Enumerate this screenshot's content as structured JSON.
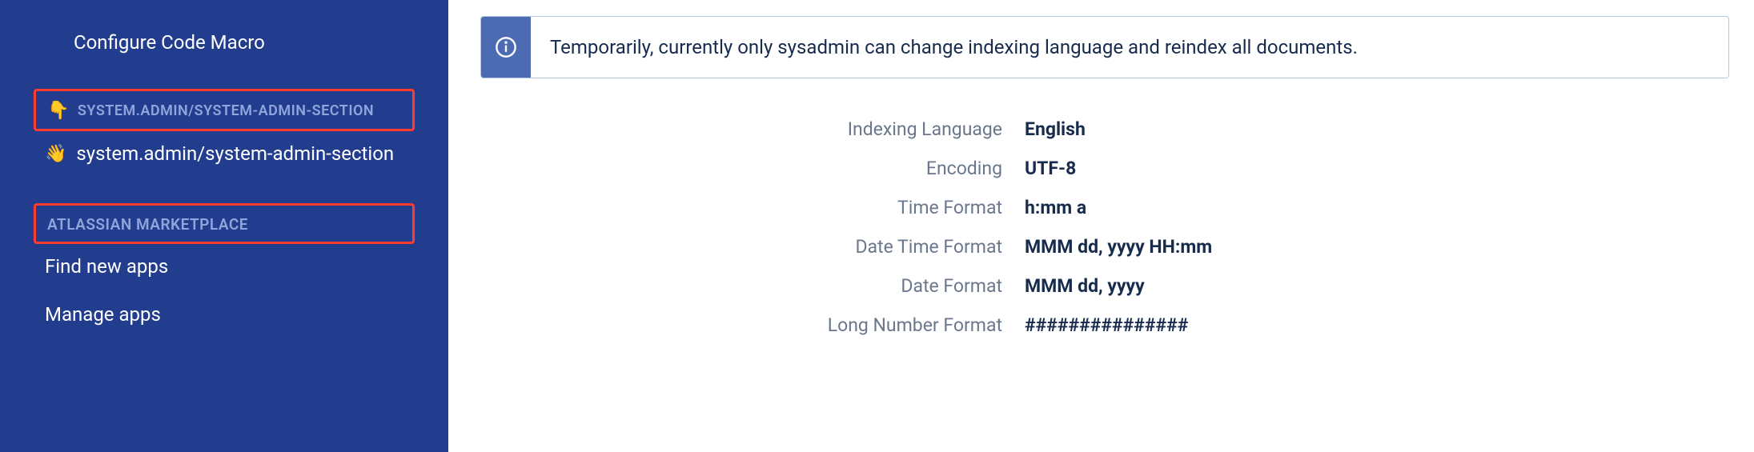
{
  "sidebar": {
    "configure_code_macro": "Configure Code Macro",
    "section1": {
      "header": "SYSTEM.ADMIN/SYSTEM-ADMIN-SECTION",
      "header_icon": "👇",
      "item_icon": "👋",
      "item_label": "system.admin/system-admin-section"
    },
    "section2": {
      "header": "ATLASSIAN MARKETPLACE",
      "items": [
        "Find new apps",
        "Manage apps"
      ]
    }
  },
  "banner": {
    "text": "Temporarily, currently only sysadmin can change indexing language and reindex all documents."
  },
  "settings": {
    "rows": [
      {
        "label": "Indexing Language",
        "value": "English"
      },
      {
        "label": "Encoding",
        "value": "UTF-8"
      },
      {
        "label": "Time Format",
        "value": "h:mm a"
      },
      {
        "label": "Date Time Format",
        "value": "MMM dd, yyyy HH:mm"
      },
      {
        "label": "Date Format",
        "value": "MMM dd, yyyy"
      },
      {
        "label": "Long Number Format",
        "value": "###############"
      }
    ]
  }
}
